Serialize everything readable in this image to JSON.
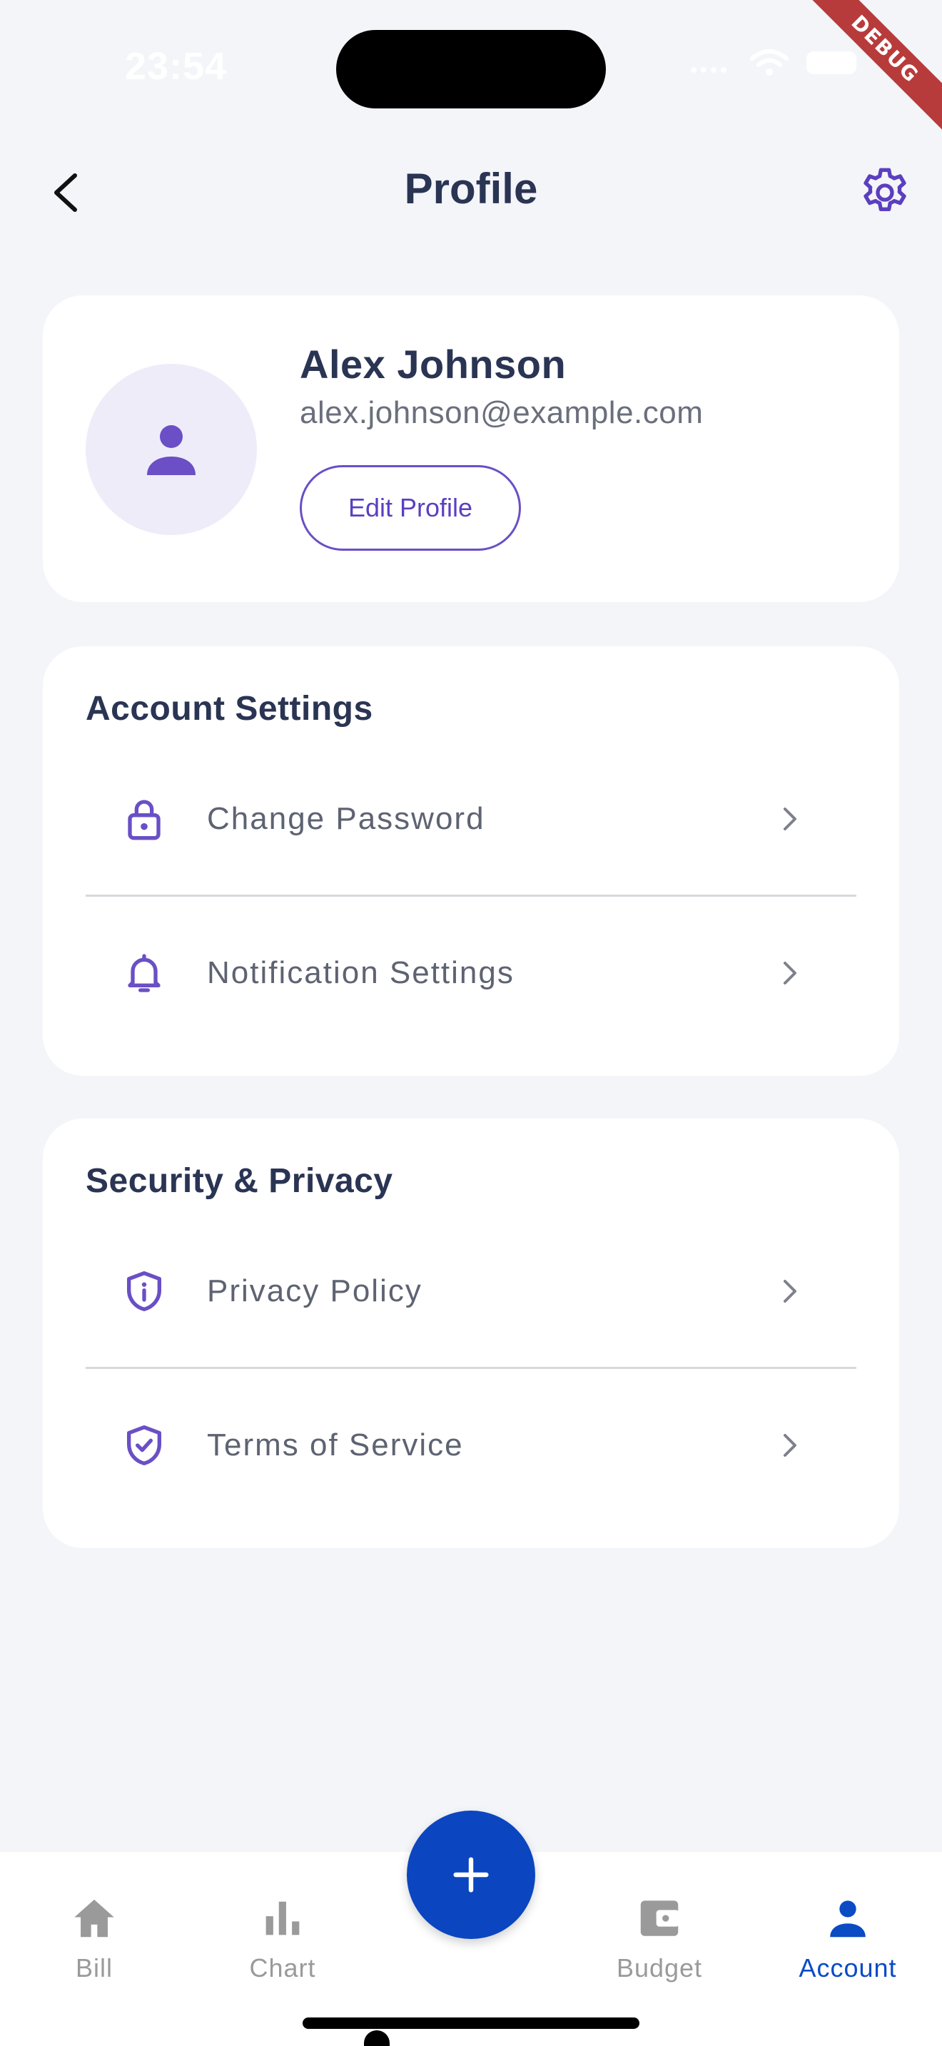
{
  "status_bar": {
    "time": "23:54",
    "debug_label": "DEBUG"
  },
  "header": {
    "title": "Profile",
    "back_icon": "chevron-left-icon",
    "settings_icon": "gear-icon"
  },
  "profile": {
    "name": "Alex Johnson",
    "email": "alex.johnson@example.com",
    "edit_button": "Edit Profile",
    "avatar_icon": "person-icon"
  },
  "account_settings": {
    "title": "Account Settings",
    "items": [
      {
        "label": "Change Password",
        "icon": "lock-icon"
      },
      {
        "label": "Notification Settings",
        "icon": "bell-icon"
      }
    ]
  },
  "security_privacy": {
    "title": "Security & Privacy",
    "items": [
      {
        "label": "Privacy Policy",
        "icon": "shield-info-icon"
      },
      {
        "label": "Terms of Service",
        "icon": "shield-check-icon"
      }
    ]
  },
  "bottom_nav": {
    "items": [
      {
        "label": "Bill",
        "icon": "home-icon",
        "active": false
      },
      {
        "label": "Chart",
        "icon": "bar-chart-icon",
        "active": false
      },
      {
        "label": "Budget",
        "icon": "wallet-icon",
        "active": false
      },
      {
        "label": "Account",
        "icon": "person-icon",
        "active": true
      }
    ],
    "fab_icon": "plus-icon"
  },
  "colors": {
    "accent_purple": "#6A4FC6",
    "primary_blue": "#0B46C0",
    "background": "#F4F5F9",
    "text_dark": "#2A3453",
    "inactive_gray": "#9A9A9A"
  }
}
